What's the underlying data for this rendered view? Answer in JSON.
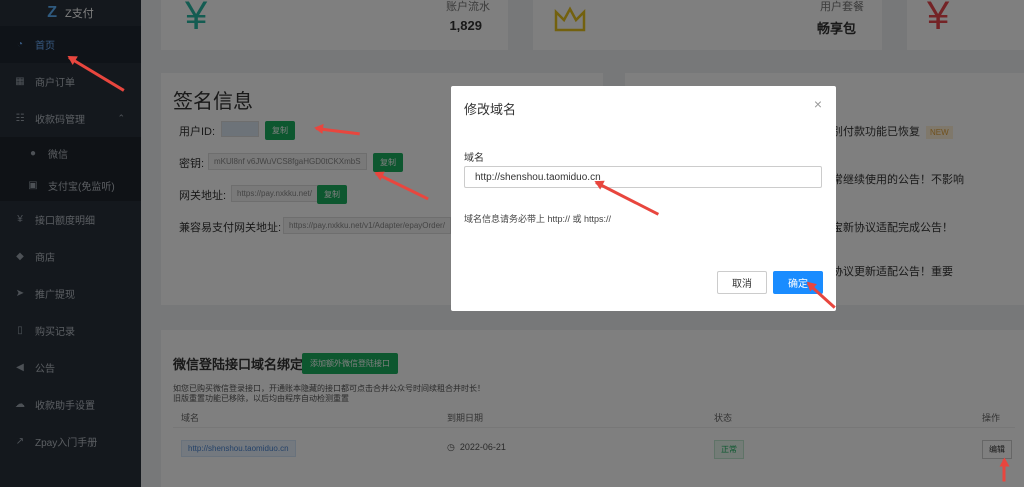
{
  "brand": {
    "name": "Z支付"
  },
  "sidebar": {
    "items": [
      {
        "label": "首页",
        "icon": "dashboard-icon"
      },
      {
        "label": "商户订单",
        "icon": "grid-icon"
      },
      {
        "label": "收款码管理",
        "icon": "list-icon"
      },
      {
        "label": "微信",
        "icon": "wechat-icon"
      },
      {
        "label": "支付宝(免监听)",
        "icon": "alipay-icon"
      },
      {
        "label": "接口额度明细",
        "icon": "yen-icon"
      },
      {
        "label": "商店",
        "icon": "shop-icon"
      },
      {
        "label": "推广提现",
        "icon": "send-icon"
      },
      {
        "label": "购买记录",
        "icon": "phone-icon"
      },
      {
        "label": "公告",
        "icon": "megaphone-icon"
      },
      {
        "label": "收款助手设置",
        "icon": "cloud-icon"
      },
      {
        "label": "Zpay入门手册",
        "icon": "external-link-icon"
      }
    ]
  },
  "stats": {
    "flow_label": "账户流水",
    "flow_value": "1,829",
    "package_label": "用户套餐",
    "package_value": "畅享包",
    "colors": {
      "teal": "#29b9a4",
      "gold": "#e6c21f",
      "red": "#e8464c"
    }
  },
  "signature": {
    "title": "签名信息",
    "user_id_label": "用户ID:",
    "key_label": "密钥:",
    "key_value": "mKUl8nf v6JWuVCS8fgaHGD0tCKXmbS",
    "gateway_label": "网关地址:",
    "gateway_value": "https://pay.nxkku.net/",
    "epay_label": "兼容易支付网关地址:",
    "epay_value": "https://pay.nxkku.net/v1/Adapter/epayOrder/",
    "copy_label": "复制"
  },
  "notices": [
    {
      "text": "识别付款功能已恢复",
      "badge": "NEW"
    },
    {
      "text": "正常继续使用的公告！不影响"
    },
    {
      "text": "付宝新协议适配完成公告！"
    },
    {
      "text": "宝协议更新适配公告！重要"
    }
  ],
  "wechat_domain": {
    "title": "微信登陆接口域名绑定",
    "add_button": "添加额外微信登陆接口",
    "desc1": "如您已购买微信登录接口，开通账本隐藏的接口都可点击合并公众号时间续租合并时长！",
    "desc2": "旧版重置功能已移除，以后均由程序自动检测重置",
    "headers": [
      "域名",
      "到期日期",
      "状态",
      "操作"
    ],
    "row": {
      "domain": "http://shenshou.taomiduo.cn",
      "expiry": "2022-06-21",
      "status": "正常",
      "action": "编辑"
    }
  },
  "modal": {
    "title": "修改域名",
    "close": "×",
    "field_label": "域名",
    "field_value": "http://shenshou.taomiduo.cn",
    "hint": "域名信息请务必带上 http:// 或 https://",
    "cancel": "取消",
    "ok": "确定"
  }
}
